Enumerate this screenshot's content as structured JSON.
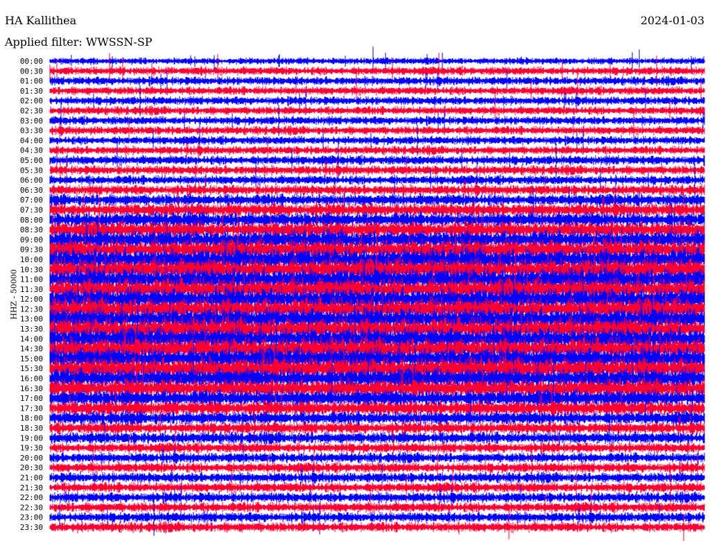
{
  "header": {
    "station": "HA Kallithea",
    "filter": "Applied filter: WWSSN-SP",
    "date": "2024-01-03"
  },
  "chart_data": {
    "type": "line",
    "title": "HA Kallithea",
    "subtitle": "Applied filter: WWSSN-SP",
    "ylabel": "HHZ - 50000",
    "date": "2024-01-03",
    "row_labels": [
      "00:00",
      "00:30",
      "01:00",
      "01:30",
      "02:00",
      "02:30",
      "03:00",
      "03:30",
      "04:00",
      "04:30",
      "05:00",
      "05:30",
      "06:00",
      "06:30",
      "07:00",
      "07:30",
      "08:00",
      "08:30",
      "09:00",
      "09:30",
      "10:00",
      "10:30",
      "11:00",
      "11:30",
      "12:00",
      "12:30",
      "13:00",
      "13:30",
      "14:00",
      "14:30",
      "15:00",
      "15:30",
      "16:00",
      "16:30",
      "17:00",
      "17:30",
      "18:00",
      "18:30",
      "19:00",
      "19:30",
      "20:00",
      "20:30",
      "21:00",
      "21:30",
      "22:00",
      "22:30",
      "23:00",
      "23:30"
    ],
    "series_colors": [
      "#0000ff",
      "#ff0033"
    ],
    "relative_amplitude": [
      0.4,
      0.5,
      0.5,
      0.5,
      0.5,
      0.5,
      0.5,
      0.5,
      0.5,
      0.5,
      0.55,
      0.55,
      0.55,
      0.6,
      0.7,
      0.8,
      0.9,
      1.0,
      1.1,
      1.2,
      1.3,
      1.3,
      1.3,
      1.3,
      1.3,
      1.3,
      1.3,
      1.3,
      1.3,
      1.3,
      1.3,
      1.3,
      1.2,
      1.1,
      1.0,
      0.9,
      0.8,
      0.7,
      0.7,
      0.6,
      0.6,
      0.6,
      0.6,
      0.6,
      0.6,
      0.6,
      0.6,
      0.6
    ]
  }
}
